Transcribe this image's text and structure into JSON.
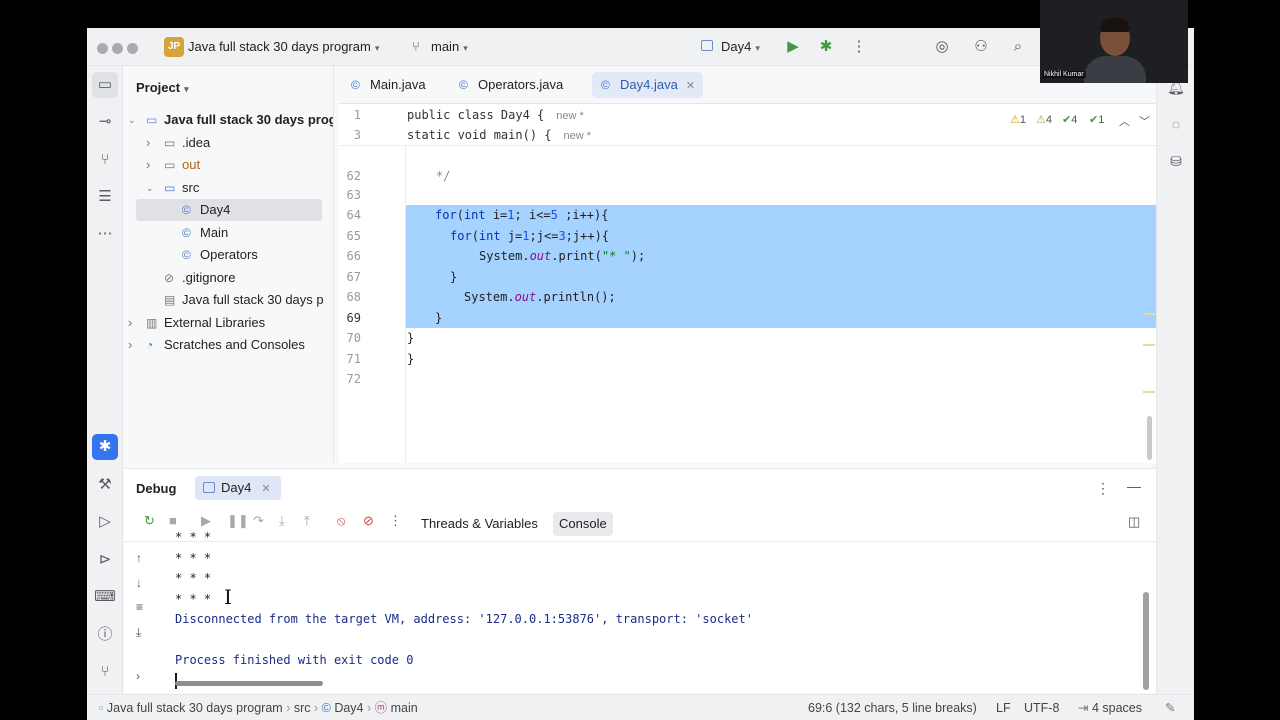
{
  "titlebar": {
    "project_badge": "JP",
    "project_name": "Java full stack 30 days program",
    "branch": "main",
    "run_config": "Day4"
  },
  "video_overlay": {
    "name": "Nikhil Kumar"
  },
  "project_panel": {
    "title": "Project",
    "tree": [
      {
        "label": "Java full stack 30 days prog",
        "level": 0,
        "arrow": "open",
        "icon": "module-folder-icon"
      },
      {
        "label": ".idea",
        "level": 1,
        "arrow": "closed",
        "icon": "folder-icon"
      },
      {
        "label": "out",
        "level": 1,
        "arrow": "closed",
        "icon": "folder-icon"
      },
      {
        "label": "src",
        "level": 1,
        "arrow": "open",
        "icon": "source-folder-icon"
      },
      {
        "label": "Day4",
        "level": 2,
        "arrow": "none",
        "icon": "java-class-icon",
        "selected": true
      },
      {
        "label": "Main",
        "level": 2,
        "arrow": "none",
        "icon": "java-class-icon"
      },
      {
        "label": "Operators",
        "level": 2,
        "arrow": "none",
        "icon": "java-class-icon"
      },
      {
        "label": ".gitignore",
        "level": 1,
        "arrow": "none",
        "icon": "ignore-file-icon"
      },
      {
        "label": "Java full stack 30 days p",
        "level": 1,
        "arrow": "none",
        "icon": "iml-file-icon"
      },
      {
        "label": "External Libraries",
        "level": 0,
        "arrow": "closed",
        "icon": "libraries-icon"
      },
      {
        "label": "Scratches and Consoles",
        "level": 0,
        "arrow": "closed",
        "icon": "scratches-icon"
      }
    ]
  },
  "editor": {
    "tabs": [
      {
        "label": "Main.java",
        "active": false
      },
      {
        "label": "Operators.java",
        "active": false
      },
      {
        "label": "Day4.java",
        "active": true
      }
    ],
    "sticky_lines": [
      {
        "line": "1",
        "code": "public class Day4 {",
        "hint": "new *"
      },
      {
        "line": "3",
        "code": "static void main() {",
        "hint": "new *"
      }
    ],
    "inspections": {
      "warnings": "1",
      "weak_warnings": "4",
      "typos": "4",
      "ok": "1"
    },
    "lines": [
      {
        "line": "62",
        "code": "    */"
      },
      {
        "line": "63",
        "code": ""
      },
      {
        "line": "64",
        "code": "for(int i=1; i<=5 ;i++){"
      },
      {
        "line": "65",
        "code": "for(int j=1;j<=3;j++){"
      },
      {
        "line": "66",
        "code": "System.out.print(\"* \");"
      },
      {
        "line": "67",
        "code": "}"
      },
      {
        "line": "68",
        "code": "System.out.println();"
      },
      {
        "line": "69",
        "code": "}"
      },
      {
        "line": "70",
        "code": "}"
      },
      {
        "line": "71",
        "code": "}"
      },
      {
        "line": "72",
        "code": ""
      }
    ]
  },
  "debug": {
    "title": "Debug",
    "session_tab": "Day4",
    "subtabs": [
      "Threads & Variables",
      "Console"
    ],
    "active_subtab": "Console",
    "console_lines": [
      "* * *",
      "* * *",
      "* * *",
      "* * *",
      "Disconnected from the target VM, address: '127.0.0.1:53876', transport: 'socket'",
      "",
      "Process finished with exit code 0"
    ]
  },
  "statusbar": {
    "breadcrumb": [
      "Java full stack 30 days program",
      "src",
      "Day4",
      "main"
    ],
    "position": "69:6 (132 chars, 5 line breaks)",
    "line_ending": "LF",
    "encoding": "UTF-8",
    "indent": "4 spaces"
  },
  "colors": {
    "selection": "#a6d2ff",
    "keyword": "#0033b3",
    "number": "#1750eb",
    "string": "#067d17",
    "field": "#871094",
    "accent": "#3574f0"
  }
}
